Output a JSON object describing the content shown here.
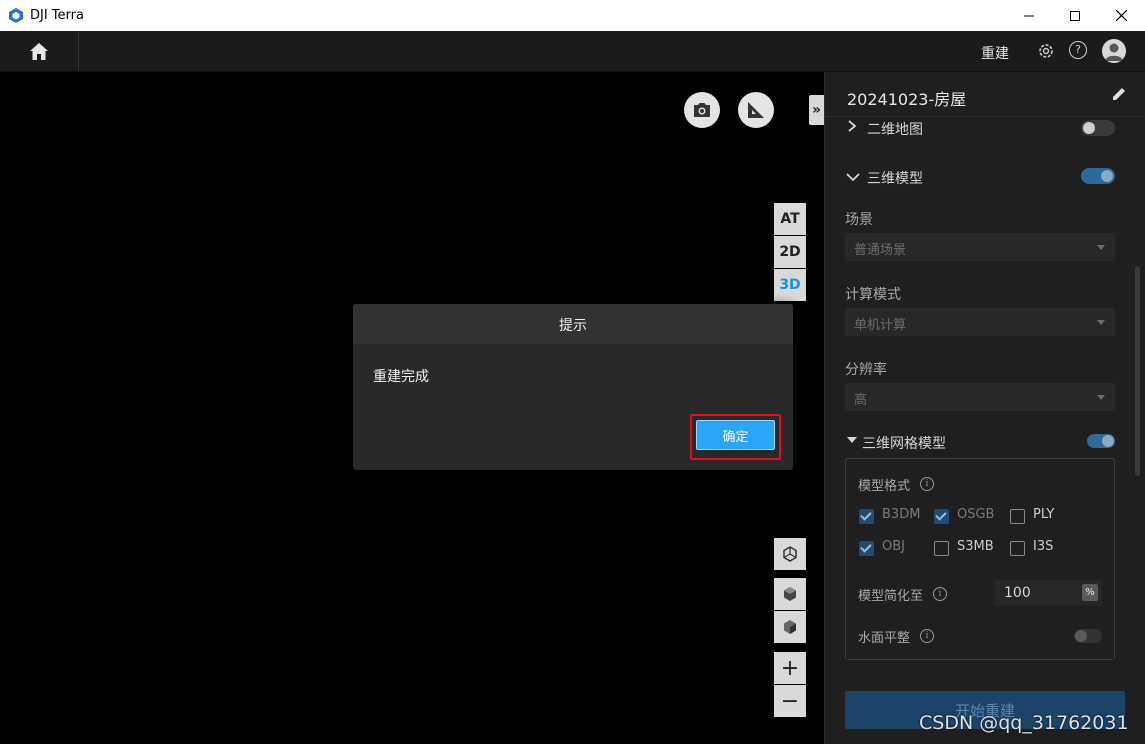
{
  "window": {
    "title": "DJI Terra",
    "controls": [
      "minimize-icon",
      "maximize-icon",
      "close-icon"
    ]
  },
  "toolbar": {
    "home_icon": "home-icon",
    "rebuild_label": "重建",
    "settings_icon": "gear-icon",
    "help_icon": "help-icon",
    "avatar_icon": "user-icon"
  },
  "viewport": {
    "top_buttons": [
      "camera-icon",
      "ruler-icon"
    ],
    "panel_toggle": "»",
    "view_modes": [
      "AT",
      "2D",
      "3D"
    ],
    "active_view_mode": "3D",
    "tools": [
      "compass-icon",
      "box-icon",
      "box-icon",
      "zoom-in-icon",
      "zoom-out-icon"
    ],
    "zoom_in": "+",
    "zoom_out": "−"
  },
  "panel": {
    "project_name": "20241023-房屋",
    "sections": {
      "map2d": {
        "label": "二维地图",
        "enabled": false
      },
      "model3d": {
        "label": "三维模型",
        "enabled": true
      }
    },
    "scene": {
      "label": "场景",
      "value": "普通场景"
    },
    "compute_mode": {
      "label": "计算模式",
      "value": "单机计算"
    },
    "resolution": {
      "label": "分辨率",
      "value": "高"
    },
    "mesh": {
      "label": "三维网格模型",
      "enabled": true,
      "format_label": "模型格式",
      "formats": [
        {
          "name": "B3DM",
          "checked": true
        },
        {
          "name": "OSGB",
          "checked": true
        },
        {
          "name": "PLY",
          "checked": false
        },
        {
          "name": "OBJ",
          "checked": true
        },
        {
          "name": "S3MB",
          "checked": false
        },
        {
          "name": "I3S",
          "checked": false
        }
      ],
      "simplify_label": "模型简化至",
      "simplify_value": "100",
      "simplify_unit": "%",
      "water_label": "水面平整",
      "water_enabled": false
    },
    "start_button": "开始重建"
  },
  "modal": {
    "title": "提示",
    "message": "重建完成",
    "confirm": "确定"
  },
  "watermark": "CSDN @qq_31762031",
  "colors": {
    "accent": "#2aa4f4",
    "highlight": "#e4101a",
    "toggle_on": "#2a6a9c",
    "panel_bg": "#1f1f1f"
  }
}
